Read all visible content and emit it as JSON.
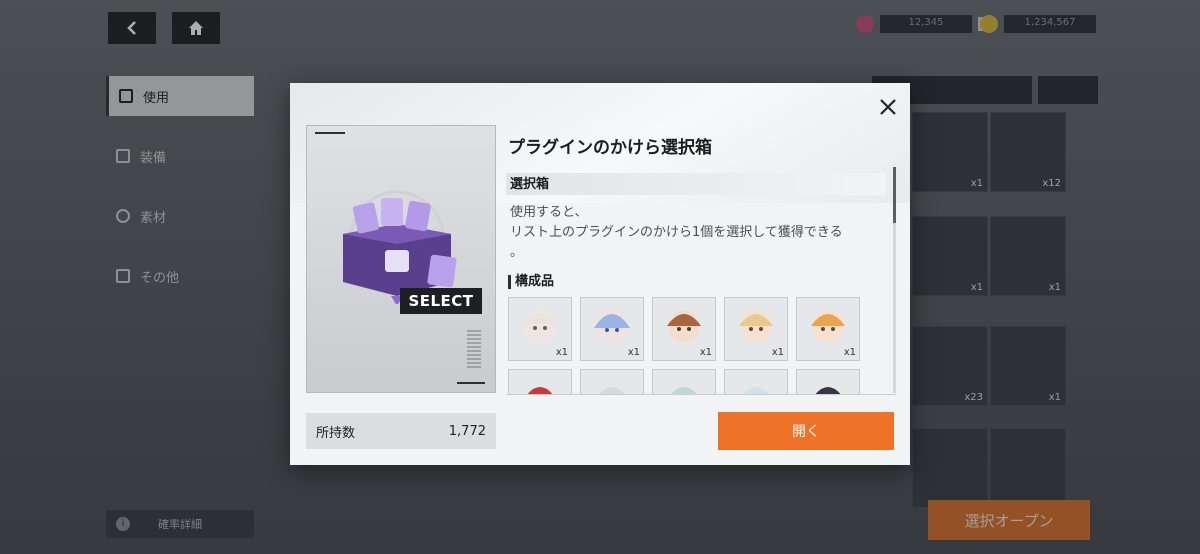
{
  "header": {
    "back_icon": "chevron-left-icon",
    "home_icon": "home-icon",
    "currency_a_value": "12,345",
    "currency_b_value": "1,234,567",
    "plus_label": "+"
  },
  "sidebar": {
    "items": [
      {
        "label": "使用",
        "icon": "use-icon"
      },
      {
        "label": "装備",
        "icon": "equip-icon"
      },
      {
        "label": "素材",
        "icon": "material-icon"
      },
      {
        "label": "その他",
        "icon": "other-icon"
      }
    ],
    "detail_label": "確率詳細",
    "info_icon_label": "i"
  },
  "background_tiles": {
    "counts": [
      "x1",
      "x12",
      "x1",
      "x1",
      "x23",
      "x1"
    ]
  },
  "open_select_label": "選択オープン",
  "modal": {
    "close_icon": "close-icon",
    "card_tag": "SELECT",
    "owned_label": "所持数",
    "owned_value": "1,772",
    "title": "プラグインのかけら選択箱",
    "category": "選択箱",
    "description_lines": [
      "使用すると、",
      "リスト上のプラグインのかけら1個を選択して獲得できる",
      "。"
    ],
    "components_label": "構成品",
    "components": [
      {
        "count": "x1"
      },
      {
        "count": "x1"
      },
      {
        "count": "x1"
      },
      {
        "count": "x1"
      },
      {
        "count": "x1"
      },
      {
        "count": ""
      },
      {
        "count": ""
      },
      {
        "count": ""
      },
      {
        "count": ""
      },
      {
        "count": ""
      }
    ],
    "open_button_label": "開く"
  },
  "colors": {
    "accent_orange": "#f07228",
    "dark_button": "#1f2226",
    "modal_bg": "#f2f3f5"
  }
}
